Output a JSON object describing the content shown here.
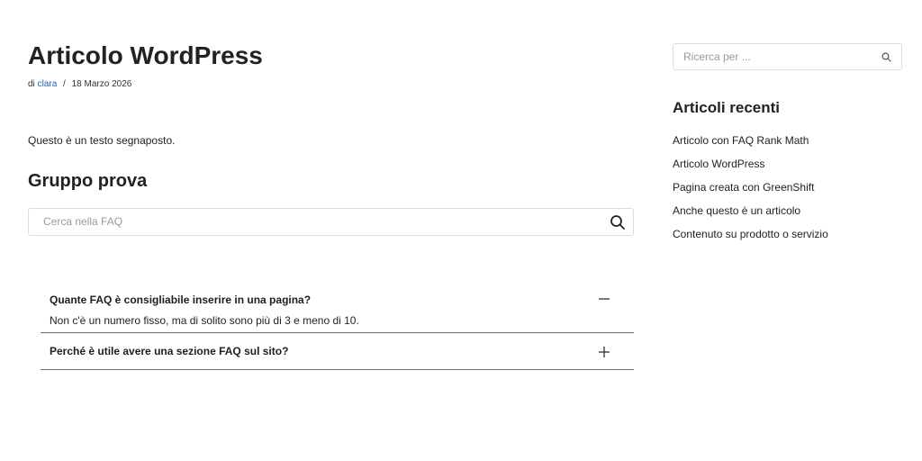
{
  "post": {
    "title": "Articolo WordPress",
    "meta_prefix": "di",
    "author": "clara",
    "separator": "/",
    "date": "18 Marzo 2026",
    "content": "Questo è un testo segnaposto."
  },
  "faq": {
    "heading": "Gruppo prova",
    "search_placeholder": "Cerca nella FAQ",
    "items": [
      {
        "question": "Quante FAQ è consigliabile inserire in una pagina?",
        "answer": "Non c'è un numero fisso, ma di solito sono più di 3 e meno di 10.",
        "expanded": true,
        "toggle_icon": "minus-icon"
      },
      {
        "question": "Perché è utile avere una sezione FAQ sul sito?",
        "answer": "",
        "expanded": false,
        "toggle_icon": "plus-icon"
      }
    ]
  },
  "sidebar": {
    "search_placeholder": "Ricerca per ...",
    "recent_title": "Articoli recenti",
    "recent_posts": [
      "Articolo con FAQ Rank Math",
      "Articolo WordPress",
      "Pagina creata con GreenShift",
      "Anche questo è un articolo",
      "Contenuto su prodotto o servizio"
    ]
  },
  "colors": {
    "link": "#2b57b5",
    "divider": "#5d6a7a",
    "border": "#dcdcdc"
  }
}
